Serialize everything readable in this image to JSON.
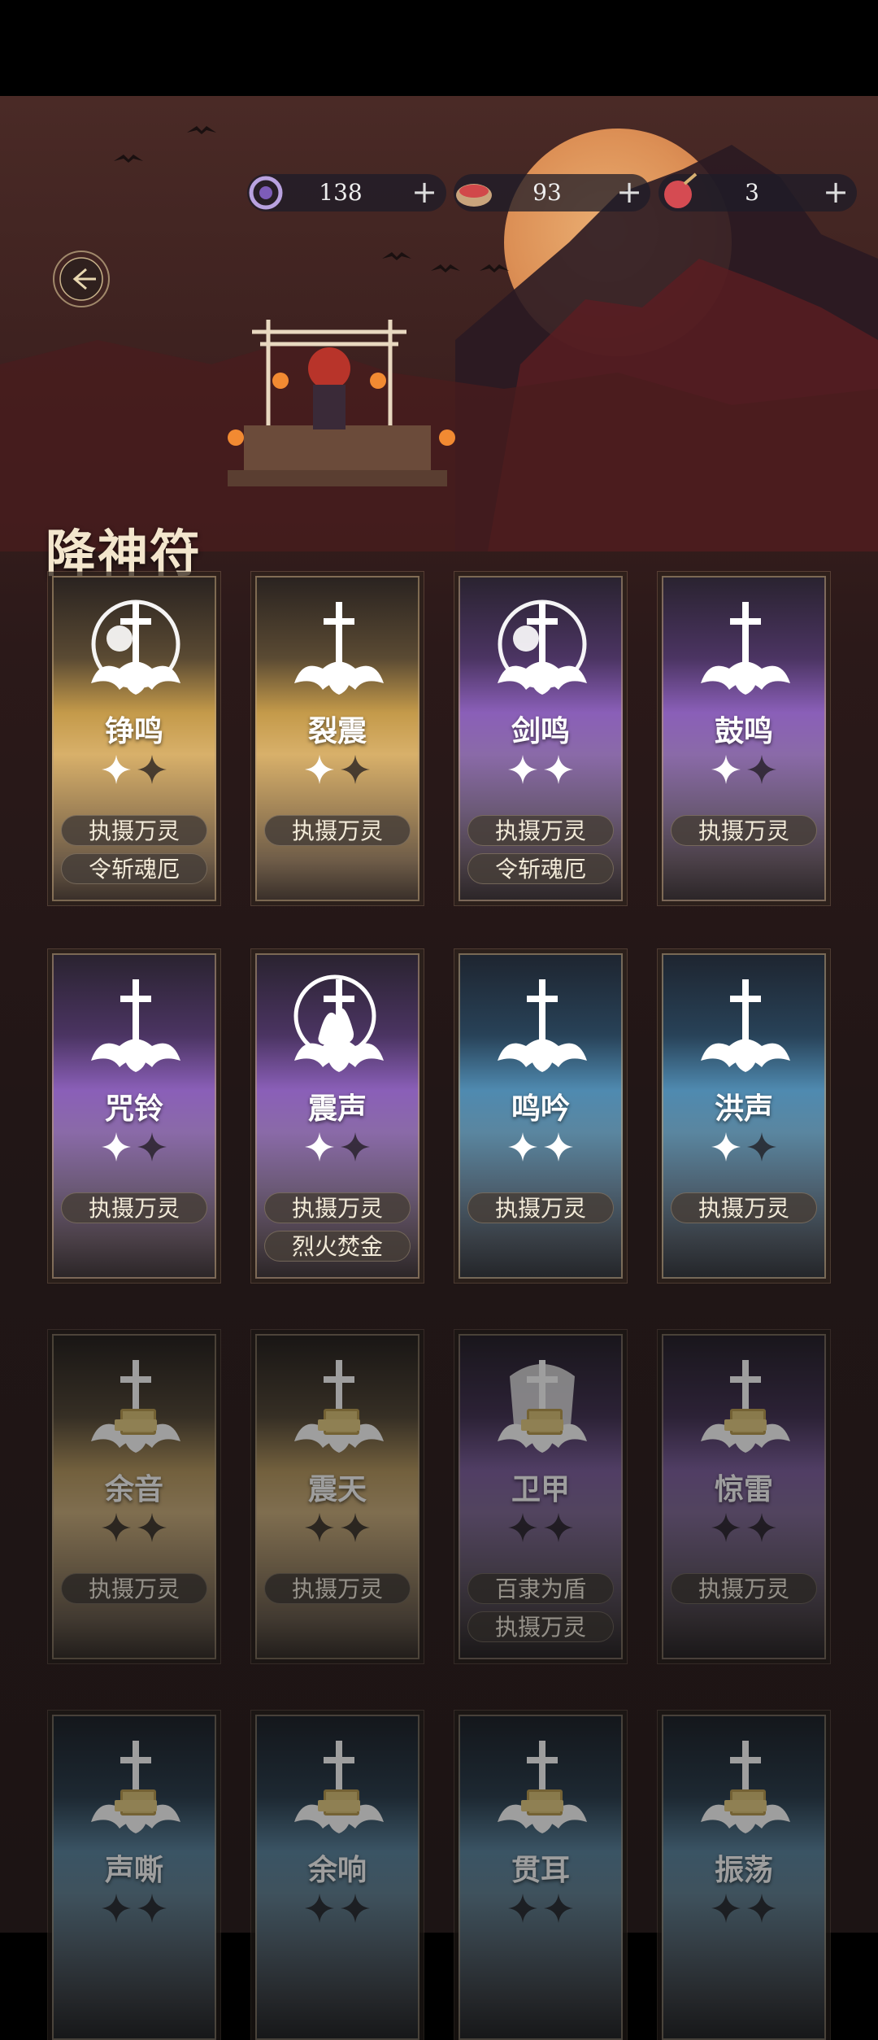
{
  "header": {
    "title": "降神符",
    "back_icon": "back-arrow-icon"
  },
  "currencies": [
    {
      "icon": "spirit-ring-icon",
      "value": "138",
      "plus": "+"
    },
    {
      "icon": "meat-bowl-icon",
      "value": "93",
      "plus": "+"
    },
    {
      "icon": "red-pouch-icon",
      "value": "3",
      "plus": "+"
    }
  ],
  "colors": {
    "gold": "#d8b06a",
    "purple": "#8a5fb8",
    "blue": "#4f8ab0",
    "title": "#f3e6cd"
  },
  "cards": [
    {
      "name": "铮鸣",
      "rarity": "gold",
      "stars_filled": 1,
      "stars_total": 2,
      "tags": [
        "执摄万灵",
        "令斩魂厄"
      ],
      "emblem": "ring-sword-emblem-icon",
      "locked": false
    },
    {
      "name": "裂震",
      "rarity": "gold",
      "stars_filled": 1,
      "stars_total": 2,
      "tags": [
        "执摄万灵"
      ],
      "emblem": "sword-cloud-emblem-icon",
      "locked": false
    },
    {
      "name": "剑鸣",
      "rarity": "purple",
      "stars_filled": 2,
      "stars_total": 2,
      "tags": [
        "执摄万灵",
        "令斩魂厄"
      ],
      "emblem": "ring-sword-emblem-icon",
      "locked": false
    },
    {
      "name": "鼓鸣",
      "rarity": "purple",
      "stars_filled": 1,
      "stars_total": 2,
      "tags": [
        "执摄万灵"
      ],
      "emblem": "sword-cloud-emblem-icon",
      "locked": false
    },
    {
      "name": "咒铃",
      "rarity": "purple",
      "stars_filled": 1,
      "stars_total": 2,
      "tags": [
        "执摄万灵"
      ],
      "emblem": "sword-cloud-emblem-icon",
      "locked": false
    },
    {
      "name": "震声",
      "rarity": "purple",
      "stars_filled": 1,
      "stars_total": 2,
      "tags": [
        "执摄万灵",
        "烈火焚金"
      ],
      "emblem": "flame-sword-emblem-icon",
      "locked": false
    },
    {
      "name": "鸣吟",
      "rarity": "blue",
      "stars_filled": 2,
      "stars_total": 2,
      "tags": [
        "执摄万灵"
      ],
      "emblem": "sword-cloud-emblem-icon",
      "locked": false
    },
    {
      "name": "洪声",
      "rarity": "blue",
      "stars_filled": 1,
      "stars_total": 2,
      "tags": [
        "执摄万灵"
      ],
      "emblem": "sword-cloud-emblem-icon",
      "locked": false
    },
    {
      "name": "余音",
      "rarity": "gold",
      "stars_filled": 0,
      "stars_total": 2,
      "tags": [
        "执摄万灵"
      ],
      "emblem": "sword-cloud-emblem-icon",
      "locked": true
    },
    {
      "name": "震天",
      "rarity": "gold",
      "stars_filled": 0,
      "stars_total": 2,
      "tags": [
        "执摄万灵"
      ],
      "emblem": "sword-cloud-emblem-icon",
      "locked": true
    },
    {
      "name": "卫甲",
      "rarity": "purple",
      "stars_filled": 0,
      "stars_total": 2,
      "tags": [
        "百隶为盾",
        "执摄万灵"
      ],
      "emblem": "demon-mask-emblem-icon",
      "locked": true
    },
    {
      "name": "惊雷",
      "rarity": "purple",
      "stars_filled": 0,
      "stars_total": 2,
      "tags": [
        "执摄万灵"
      ],
      "emblem": "sword-cloud-emblem-icon",
      "locked": true
    },
    {
      "name": "声嘶",
      "rarity": "blue",
      "stars_filled": 0,
      "stars_total": 2,
      "tags": [],
      "emblem": "sword-cloud-emblem-icon",
      "locked": true
    },
    {
      "name": "余响",
      "rarity": "blue",
      "stars_filled": 0,
      "stars_total": 2,
      "tags": [],
      "emblem": "sword-cloud-emblem-icon",
      "locked": true
    },
    {
      "name": "贯耳",
      "rarity": "blue",
      "stars_filled": 0,
      "stars_total": 2,
      "tags": [],
      "emblem": "sword-cloud-emblem-icon",
      "locked": true
    },
    {
      "name": "振荡",
      "rarity": "blue",
      "stars_filled": 0,
      "stars_total": 2,
      "tags": [],
      "emblem": "sword-cloud-emblem-icon",
      "locked": true
    }
  ]
}
